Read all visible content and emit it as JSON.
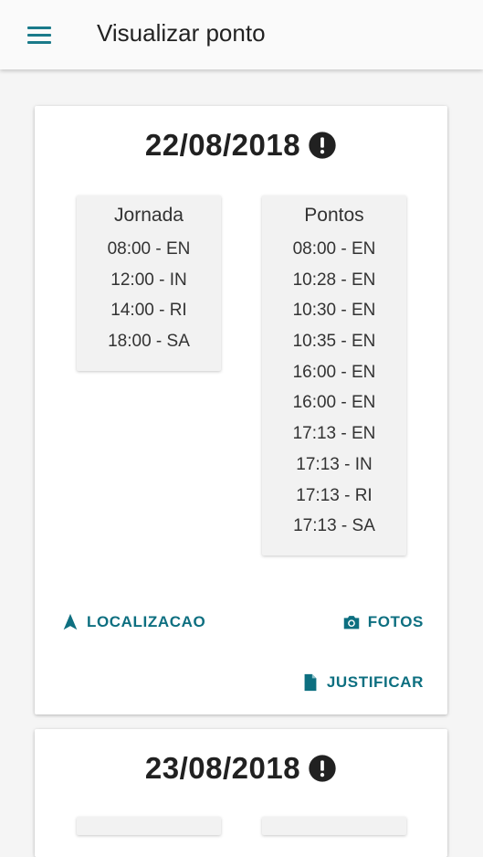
{
  "appbar": {
    "title": "Visualizar ponto",
    "menu_icon": "menu-icon"
  },
  "colors": {
    "accent": "#0d6f80",
    "card_bg": "#ffffff",
    "panel_bg": "#f2f2f2"
  },
  "cards": [
    {
      "date": "22/08/2018",
      "status_icon": "alert-circle-icon",
      "jornada": {
        "title": "Jornada",
        "entries": [
          "08:00 - EN",
          "12:00 - IN",
          "14:00 - RI",
          "18:00 - SA"
        ]
      },
      "pontos": {
        "title": "Pontos",
        "entries": [
          "08:00 - EN",
          "10:28 - EN",
          "10:30 - EN",
          "10:35 - EN",
          "16:00 - EN",
          "16:00 - EN",
          "17:13 - EN",
          "17:13 - IN",
          "17:13 - RI",
          "17:13 - SA"
        ]
      },
      "actions": {
        "localizacao": "LOCALIZACAO",
        "fotos": "FOTOS",
        "justificar": "JUSTIFICAR"
      }
    },
    {
      "date": "23/08/2018",
      "status_icon": "alert-circle-icon"
    }
  ]
}
